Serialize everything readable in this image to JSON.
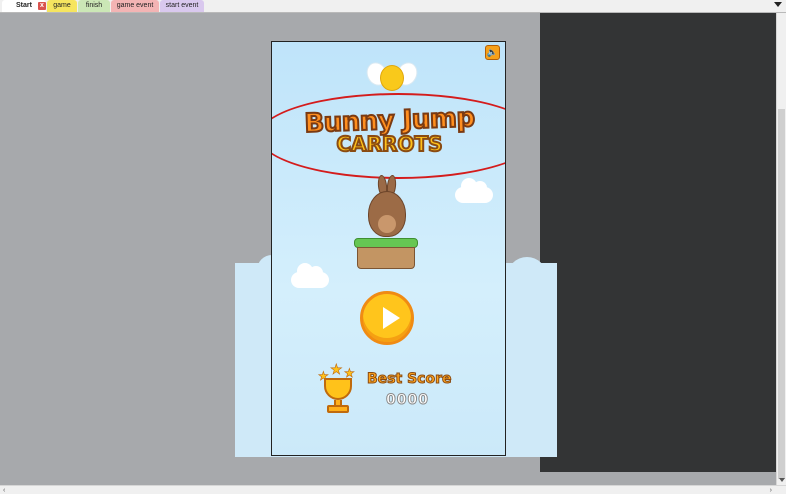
{
  "tabs": [
    {
      "label": "Start",
      "color": "#ffffff",
      "active": true
    },
    {
      "label": "game",
      "color": "#f6e55f"
    },
    {
      "label": "finish",
      "color": "#cbe7b6"
    },
    {
      "label": "game event",
      "color": "#f3b4b4"
    },
    {
      "label": "start event",
      "color": "#d9c8ee"
    }
  ],
  "tab_close_glyph": "x",
  "game": {
    "logo_line1": "Bunny Jump",
    "logo_line2": "CARROTS",
    "best_score_label": "Best Score",
    "best_score_value": "0000",
    "highlight_color": "#d41c1c"
  },
  "icons": {
    "speaker": "speaker-icon",
    "play": "play-icon",
    "trophy": "trophy-icon",
    "star": "star-icon"
  }
}
